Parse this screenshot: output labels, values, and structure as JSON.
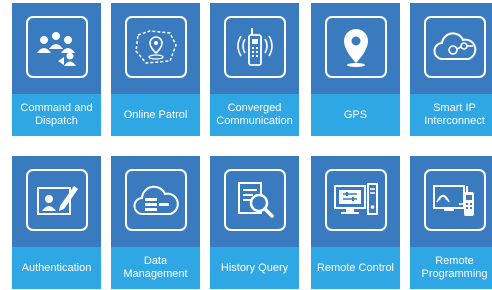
{
  "tiles": [
    {
      "label": "Command and Dispatch",
      "icon": "people-dispatch-icon"
    },
    {
      "label": "Online Patrol",
      "icon": "map-pin-route-icon"
    },
    {
      "label": "Converged Communication",
      "icon": "radio-walkie-talkie-icon"
    },
    {
      "label": "GPS",
      "icon": "location-pin-icon"
    },
    {
      "label": "Smart IP Interconnect",
      "icon": "cloud-network-icon"
    },
    {
      "label": "Authentication",
      "icon": "id-card-pen-icon"
    },
    {
      "label": "Data Management",
      "icon": "cloud-database-icon"
    },
    {
      "label": "History Query",
      "icon": "document-search-icon"
    },
    {
      "label": "Remote Control",
      "icon": "computer-control-icon"
    },
    {
      "label": "Remote Programming",
      "icon": "radio-programming-icon"
    }
  ],
  "colors": {
    "tile_bg": "#3a7bc0",
    "label_bg": "#2fa7e4",
    "text": "#ffffff"
  }
}
